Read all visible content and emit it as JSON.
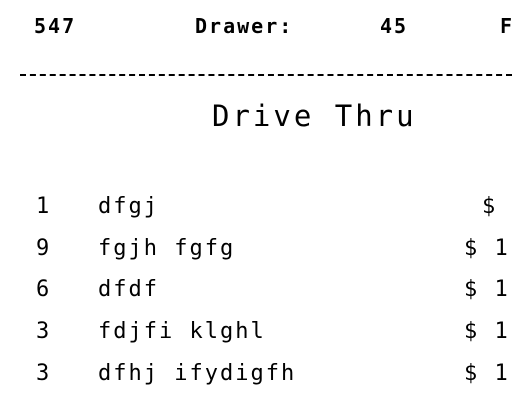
{
  "header": {
    "order_number": "547",
    "drawer_label": "Drawer:",
    "drawer_value": "45",
    "truncated_text": "F"
  },
  "title": "Drive Thru",
  "items": [
    {
      "qty": "1",
      "desc": "dfgj",
      "price": "$"
    },
    {
      "qty": "9",
      "desc": "fgjh fgfg",
      "price": "$ 1"
    },
    {
      "qty": "6",
      "desc": "dfdf",
      "price": "$ 1"
    },
    {
      "qty": "3",
      "desc": "fdjfi klghl",
      "price": "$ 1"
    },
    {
      "qty": "3",
      "desc": "dfhj ifydigfh",
      "price": "$ 1"
    }
  ]
}
